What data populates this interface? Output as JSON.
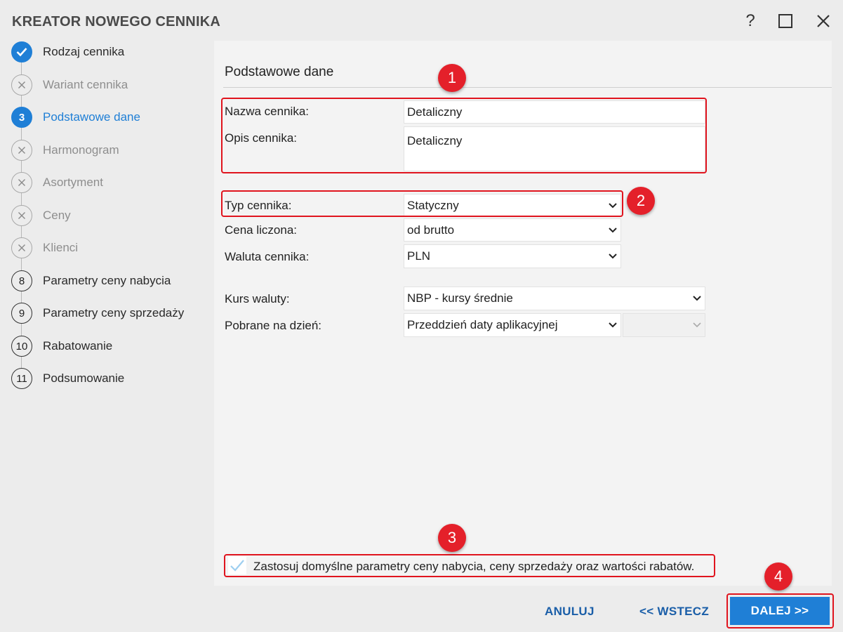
{
  "window": {
    "title": "KREATOR NOWEGO CENNIKA",
    "help_label": "?"
  },
  "steps": [
    {
      "number": "",
      "label": "Rodzaj cennika",
      "state": "done",
      "icon": "check-icon"
    },
    {
      "number": "",
      "label": "Wariant cennika",
      "state": "skipped",
      "icon": "x-icon"
    },
    {
      "number": "3",
      "label": "Podstawowe dane",
      "state": "current"
    },
    {
      "number": "",
      "label": "Harmonogram",
      "state": "skipped",
      "icon": "x-icon"
    },
    {
      "number": "",
      "label": "Asortyment",
      "state": "skipped",
      "icon": "x-icon"
    },
    {
      "number": "",
      "label": "Ceny",
      "state": "skipped",
      "icon": "x-icon"
    },
    {
      "number": "",
      "label": "Klienci",
      "state": "skipped",
      "icon": "x-icon"
    },
    {
      "number": "8",
      "label": "Parametry ceny nabycia",
      "state": "pending"
    },
    {
      "number": "9",
      "label": "Parametry ceny sprzedaży",
      "state": "pending"
    },
    {
      "number": "10",
      "label": "Rabatowanie",
      "state": "pending"
    },
    {
      "number": "11",
      "label": "Podsumowanie",
      "state": "pending"
    }
  ],
  "form": {
    "section_title": "Podstawowe dane",
    "name_label": "Nazwa cennika:",
    "name_value": "Detaliczny",
    "desc_label": "Opis cennika:",
    "desc_value": "Detaliczny",
    "type_label": "Typ cennika:",
    "type_value": "Statyczny",
    "price_label": "Cena liczona:",
    "price_value": "od brutto",
    "currency_label": "Waluta cennika:",
    "currency_value": "PLN",
    "rate_label": "Kurs waluty:",
    "rate_value": "NBP - kursy średnie",
    "date_label": "Pobrane na dzień:",
    "date_value": "Przeddzień daty aplikacyjnej",
    "date_extra_value": ""
  },
  "defaults_checkbox": {
    "label": "Zastosuj domyślne parametry ceny nabycia, ceny sprzedaży oraz wartości rabatów.",
    "checked": true
  },
  "annotations": [
    "1",
    "2",
    "3",
    "4"
  ],
  "footer": {
    "cancel_label": "ANULUJ",
    "back_label": "<< WSTECZ",
    "next_label": "DALEJ >>"
  },
  "colors": {
    "accent": "#1f7fd6",
    "link": "#1a5ea8",
    "annotation_red": "#e4202a"
  }
}
